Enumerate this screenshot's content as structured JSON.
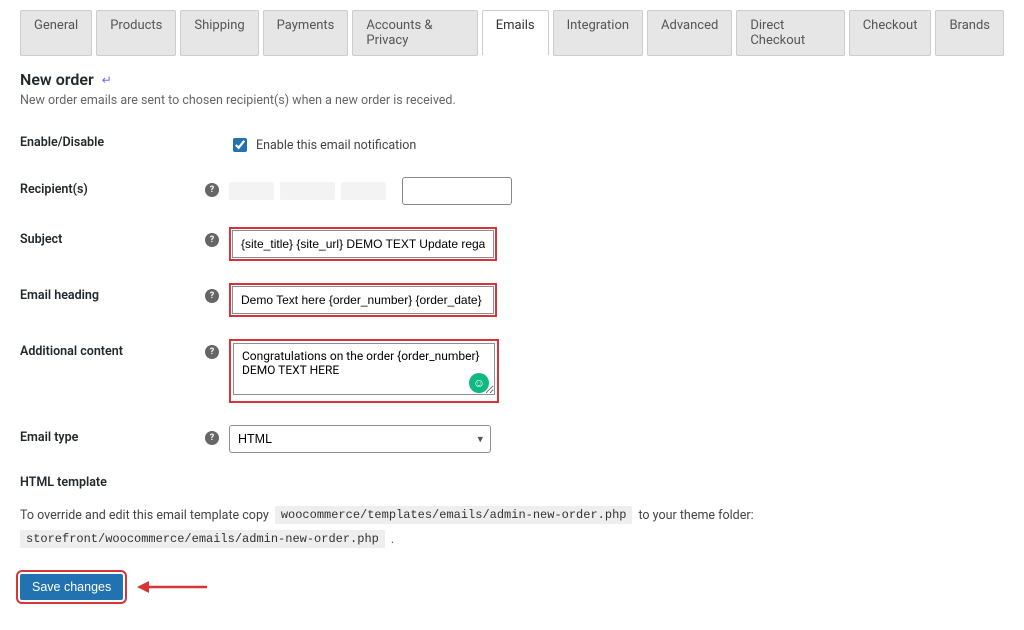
{
  "tabs": [
    {
      "label": "General"
    },
    {
      "label": "Products"
    },
    {
      "label": "Shipping"
    },
    {
      "label": "Payments"
    },
    {
      "label": "Accounts & Privacy"
    },
    {
      "label": "Emails"
    },
    {
      "label": "Integration"
    },
    {
      "label": "Advanced"
    },
    {
      "label": "Direct Checkout"
    },
    {
      "label": "Checkout"
    },
    {
      "label": "Brands"
    }
  ],
  "active_tab": "Emails",
  "page": {
    "title": "New order",
    "description": "New order emails are sent to chosen recipient(s) when a new order is received."
  },
  "form": {
    "enable_label": "Enable/Disable",
    "enable_cb_text": "Enable this email notification",
    "enable_checked": true,
    "recipients_label": "Recipient(s)",
    "subject_label": "Subject",
    "subject_value": "{site_title} {site_url} DEMO TEXT Update regarding your order {order_number}",
    "heading_label": "Email heading",
    "heading_value": "Demo Text here {order_number} {order_date}",
    "additional_label": "Additional content",
    "additional_value": "Congratulations on the order {order_number} DEMO TEXT HERE",
    "emailtype_label": "Email type",
    "emailtype_value": "HTML"
  },
  "template": {
    "section": "HTML template",
    "pre_text": "To override and edit this email template copy",
    "src_path": "woocommerce/templates/emails/admin-new-order.php",
    "mid_text": "to your theme folder:",
    "dst_path": "storefront/woocommerce/emails/admin-new-order.php",
    "period": "."
  },
  "actions": {
    "save": "Save changes"
  }
}
